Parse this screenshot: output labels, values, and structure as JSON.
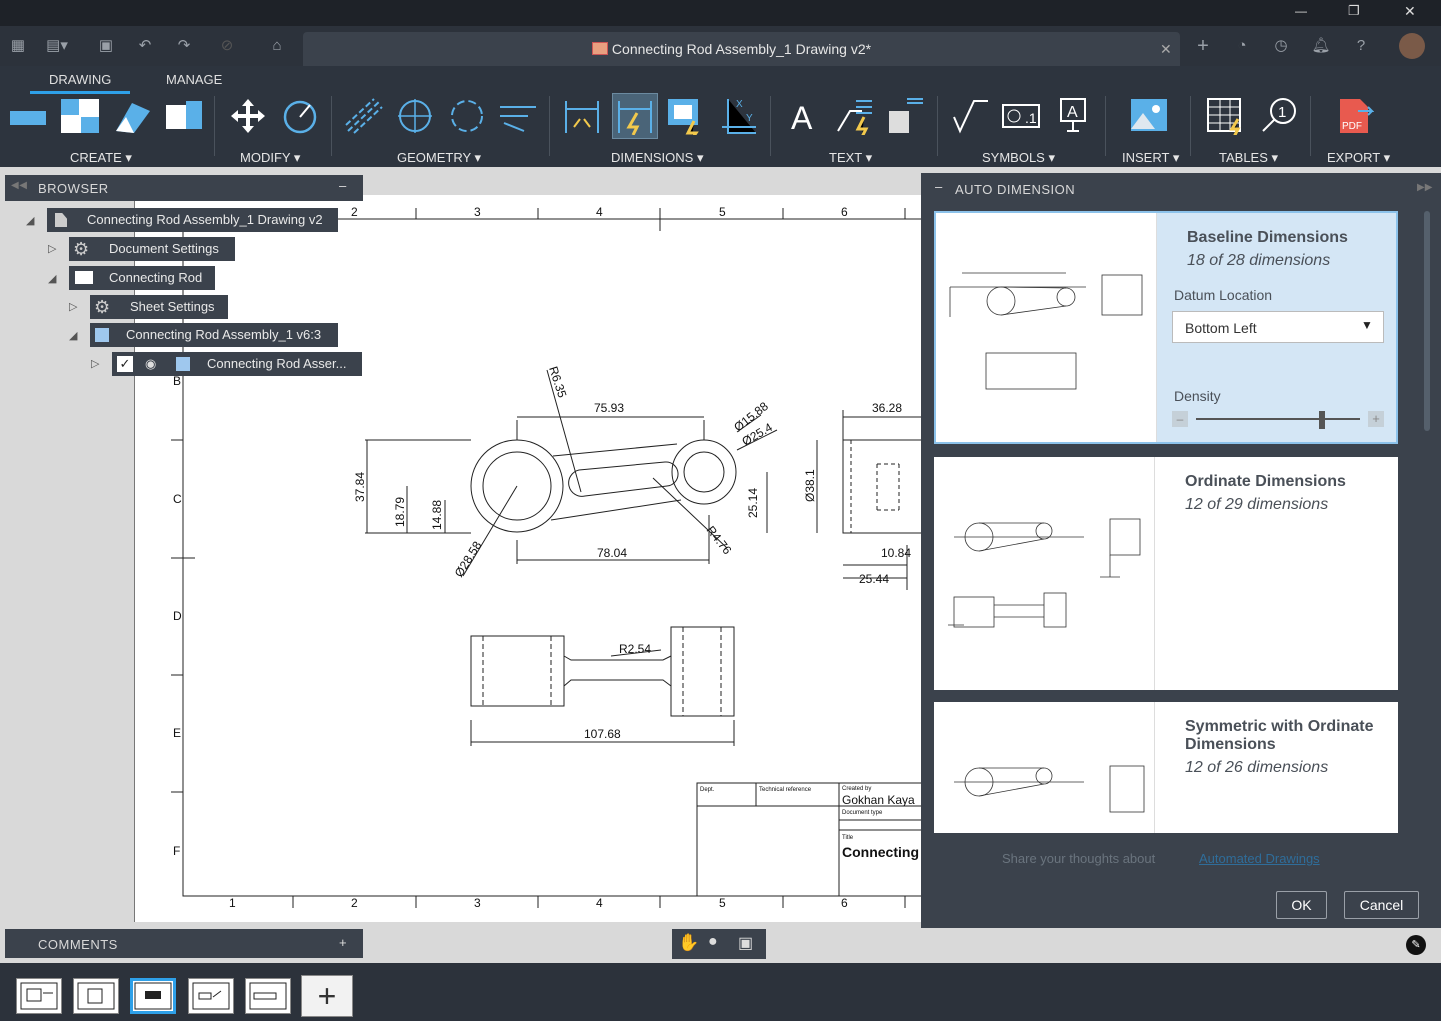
{
  "window": {
    "minimize_glyph": "—",
    "maximize_glyph": "❐",
    "close_glyph": "✕"
  },
  "doc_tab": {
    "title": "Connecting Rod Assembly_1 Drawing v2*",
    "close": "✕"
  },
  "ribbon": {
    "tabs": [
      "DRAWING",
      "MANAGE"
    ],
    "groups": [
      "CREATE ▾",
      "MODIFY ▾",
      "GEOMETRY ▾",
      "DIMENSIONS ▾",
      "TEXT ▾",
      "SYMBOLS ▾",
      "INSERT ▾",
      "TABLES ▾",
      "EXPORT ▾"
    ]
  },
  "browser": {
    "title": "BROWSER",
    "nodes": [
      "Connecting Rod Assembly_1 Drawing v2",
      "Document Settings",
      "Connecting Rod",
      "Sheet Settings",
      "Connecting Rod Assembly_1 v6:3",
      "Connecting Rod Asser..."
    ]
  },
  "comments": {
    "title": "COMMENTS",
    "plus": "+"
  },
  "drawing": {
    "border_cols": [
      "1",
      "2",
      "3",
      "4",
      "5",
      "6"
    ],
    "border_rows": [
      "B",
      "C",
      "D",
      "E",
      "F"
    ],
    "dims": [
      "75.93",
      "R6.35",
      "Ø15.88",
      "Ø25.4",
      "36.28",
      "37.84",
      "18.79",
      "14.88",
      "25.14",
      "Ø38.1",
      "78.04",
      "R4.76",
      "Ø28.58",
      "10.84",
      "25.44",
      "R2.54",
      "107.68"
    ],
    "title_block": {
      "dept": "Dept.",
      "tech_ref": "Technical reference",
      "created_by_lbl": "Created by",
      "created_by": "Gokhan Kaya",
      "doc_type_lbl": "Document type",
      "title_lbl": "Title",
      "title": "Connecting Rod"
    }
  },
  "auto_dim": {
    "title": "AUTO DIMENSION",
    "cards": [
      {
        "title": "Baseline Dimensions",
        "sub": "18 of 28 dimensions"
      },
      {
        "title": "Ordinate Dimensions",
        "sub": "12 of 29 dimensions"
      },
      {
        "title": "Symmetric with Ordinate Dimensions",
        "sub": "12 of 26 dimensions"
      }
    ],
    "datum_label": "Datum Location",
    "datum_value": "Bottom Left",
    "density_label": "Density",
    "density_level": 0.8,
    "feedback_text": "Share your thoughts about",
    "feedback_link": "Automated Drawings",
    "ok": "OK",
    "cancel": "Cancel"
  },
  "sheets_add": "+"
}
